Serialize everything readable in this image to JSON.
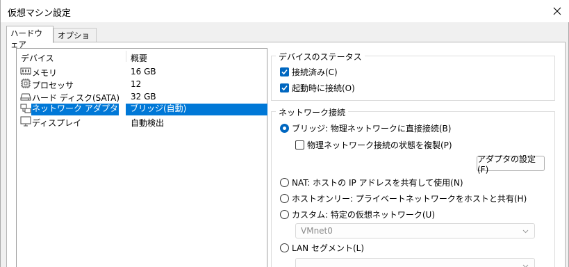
{
  "window": {
    "title": "仮想マシン設定"
  },
  "tabs": [
    {
      "label": "ハードウェア"
    },
    {
      "label": "オプション"
    }
  ],
  "device_list": {
    "headers": {
      "device": "デバイス",
      "summary": "概要"
    },
    "rows": [
      {
        "icon": "memory-icon",
        "name": "メモリ",
        "value": "16 GB"
      },
      {
        "icon": "processor-icon",
        "name": "プロセッサ",
        "value": "12"
      },
      {
        "icon": "hard-disk-icon",
        "name": "ハード ディスク(SATA)",
        "value": "32 GB"
      },
      {
        "icon": "network-adapter-icon",
        "name": "ネットワーク アダプタ",
        "value": "ブリッジ(自動)"
      },
      {
        "icon": "display-icon",
        "name": "ディスプレイ",
        "value": "自動検出"
      }
    ],
    "selected_index": 3
  },
  "device_status": {
    "title": "デバイスのステータス",
    "connected": {
      "label": "接続済み(C)",
      "checked": true
    },
    "connect_at_power_on": {
      "label": "起動時に接続(O)",
      "checked": true
    }
  },
  "network": {
    "title": "ネットワーク接続",
    "bridged": {
      "label": "ブリッジ: 物理ネットワークに直接接続(B)",
      "selected": true
    },
    "replicate": {
      "label": "物理ネットワーク接続の状態を複製(P)",
      "checked": false
    },
    "adapter_button": "アダプタの設定(F)",
    "nat": {
      "label": "NAT: ホストの IP アドレスを共有して使用(N)",
      "selected": false
    },
    "host_only": {
      "label": "ホストオンリー: プライベートネットワークをホストと共有(H)",
      "selected": false
    },
    "custom": {
      "label": "カスタム: 特定の仮想ネットワーク(U)",
      "selected": false
    },
    "vmnet_select": {
      "value": "VMnet0"
    },
    "lan_segment": {
      "label": "LAN セグメント(L)",
      "selected": false
    },
    "lan_select": {
      "value": ""
    }
  },
  "colors": {
    "accent": "#0067c0",
    "selection": "#0078d7"
  }
}
